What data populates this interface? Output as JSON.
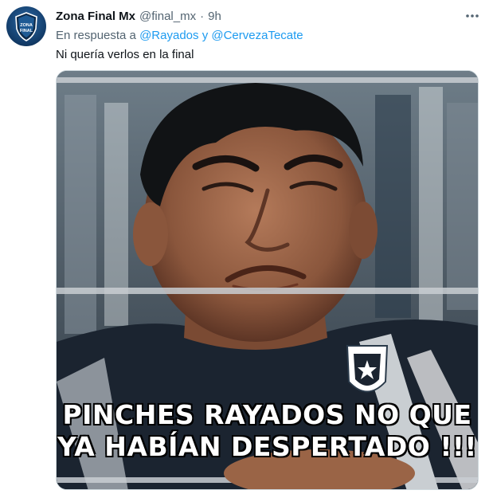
{
  "tweet": {
    "display_name": "Zona Final Mx",
    "handle": "@final_mx",
    "separator": "·",
    "time": "9h",
    "reply_prefix": "En respuesta a",
    "mention_1": "@Rayados",
    "reply_joiner": "y",
    "mention_2": "@CervezaTecate",
    "text": "Ni quería verlos en la final",
    "avatar_text_1": "ZONA",
    "avatar_text_2": "FINAL"
  },
  "media": {
    "caption_line_1": "PINCHES RAYADOS NO QUE",
    "caption_line_2": "YA HABÍAN DESPERTADO !!!"
  },
  "icons": {
    "more": "more-options-icon"
  },
  "colors": {
    "text_primary": "#0f1419",
    "text_secondary": "#536471",
    "link": "#1d9bf0",
    "border": "#cfd9de"
  }
}
